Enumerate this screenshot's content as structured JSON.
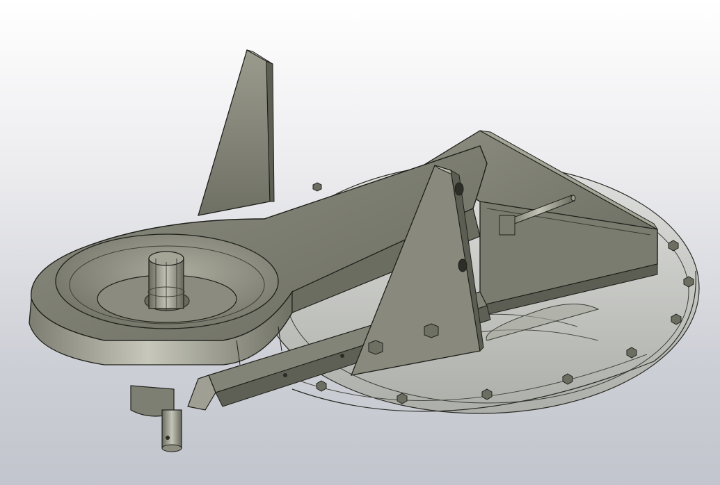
{
  "viewport": {
    "background_top": "#ffffff",
    "background_bottom": "#c2c5cd"
  },
  "model": {
    "body_color": "#8a8b7d",
    "shadow_color": "#5c5d52",
    "highlight_color": "#b3b4a6",
    "edge_color": "#23241f",
    "glass_color": "#c9cbc4",
    "parts": [
      "channel-bracket",
      "gusset-plate",
      "belt-housing",
      "pulley-cup",
      "splined-shaft",
      "drive-shaft",
      "cutter-deck",
      "deck-bolts",
      "rear-frame",
      "tension-rod"
    ]
  }
}
